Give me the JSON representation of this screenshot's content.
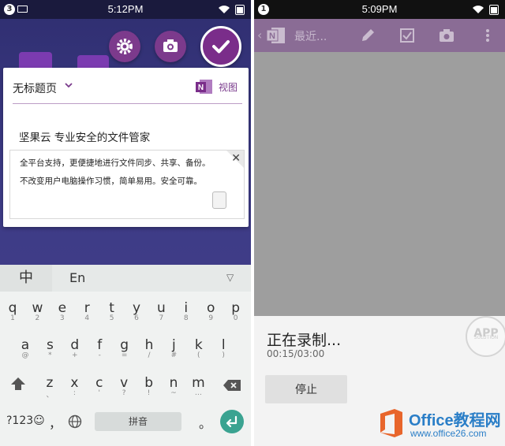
{
  "left": {
    "status": {
      "notification_count": "3",
      "time": "5:12PM"
    },
    "note": {
      "title": "无标题页",
      "view_label": "视图",
      "heading": "坚果云  专业安全的文件管家",
      "clip_lines": [
        "全平台支持，更便捷地进行文件同步、共享、备份。",
        "不改变用户电脑操作习惯，简单易用。安全可靠。"
      ],
      "close_glyph": "✕"
    },
    "keyboard": {
      "lang_zh": "中",
      "lang_en": "En",
      "collapse": "▽",
      "row1": [
        {
          "m": "q",
          "s": "1"
        },
        {
          "m": "w",
          "s": "2"
        },
        {
          "m": "e",
          "s": "3"
        },
        {
          "m": "r",
          "s": "4"
        },
        {
          "m": "t",
          "s": "5"
        },
        {
          "m": "y",
          "s": "6"
        },
        {
          "m": "u",
          "s": "7"
        },
        {
          "m": "i",
          "s": "8"
        },
        {
          "m": "o",
          "s": "9"
        },
        {
          "m": "p",
          "s": "0"
        }
      ],
      "row2": [
        {
          "m": "a",
          "s": "@"
        },
        {
          "m": "s",
          "s": "*"
        },
        {
          "m": "d",
          "s": "+"
        },
        {
          "m": "f",
          "s": "-"
        },
        {
          "m": "g",
          "s": "="
        },
        {
          "m": "h",
          "s": "/"
        },
        {
          "m": "j",
          "s": "#"
        },
        {
          "m": "k",
          "s": "("
        },
        {
          "m": "l",
          "s": ")"
        }
      ],
      "row3": [
        {
          "m": "z",
          "s": "、"
        },
        {
          "m": "x",
          "s": ":"
        },
        {
          "m": "c",
          "s": "'"
        },
        {
          "m": "v",
          "s": "?"
        },
        {
          "m": "b",
          "s": "!"
        },
        {
          "m": "n",
          "s": "~"
        },
        {
          "m": "m",
          "s": "…"
        }
      ],
      "sym": "?123",
      "comma": "，",
      "space": "拼音",
      "period": "。"
    }
  },
  "right": {
    "status": {
      "notification_count": "1",
      "time": "5:09PM"
    },
    "toolbar": {
      "back": "‹",
      "recent": "最近..."
    },
    "recording": {
      "title": "正在录制...",
      "duration": "00:15/03:00",
      "stop": "停止"
    },
    "badge": {
      "main": "APP",
      "sub": "SOLUTION"
    }
  },
  "watermark": {
    "line1": "Office教程网",
    "line2": "www.office26.com"
  },
  "colors": {
    "accent": "#7a2d8a",
    "keyboard_enter": "#3aa391",
    "toolbar": "#8a6c95",
    "watermark": "#2a7ec7"
  }
}
